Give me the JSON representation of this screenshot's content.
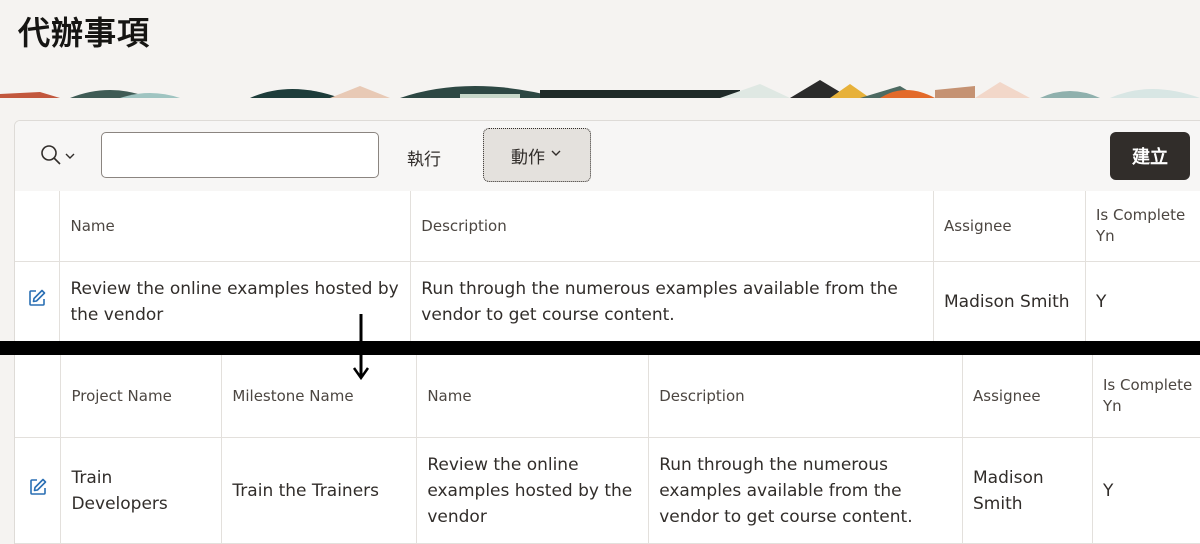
{
  "page": {
    "title": "代辦事項"
  },
  "toolbar": {
    "go_label": "執行",
    "actions_label": "動作",
    "create_label": "建立",
    "search_value": "",
    "search_placeholder": ""
  },
  "grid_before": {
    "headers": [
      "Name",
      "Description",
      "Assignee",
      "Is Complete Yn"
    ],
    "row": {
      "name": "Review the online examples hosted by the vendor",
      "description": "Run through the numerous examples available from the vendor to get course content.",
      "assignee": "Madison Smith",
      "is_complete": "Y"
    }
  },
  "grid_after": {
    "headers": [
      "Project Name",
      "Milestone Name",
      "Name",
      "Description",
      "Assignee",
      "Is Complete Yn"
    ],
    "row": {
      "project_name": "Train Developers",
      "milestone_name": "Train the Trainers",
      "name": "Review the online examples hosted by the vendor",
      "description": "Run through the numerous examples available from the vendor to get course content.",
      "assignee": "Madison Smith",
      "is_complete": "Y"
    }
  },
  "colors": {
    "accent_dark": "#312d2a",
    "edit_icon": "#2a6fb4",
    "page_bg": "#f5f3f1"
  },
  "icons": [
    "search-icon",
    "chevron-down-icon",
    "edit-icon",
    "down-arrow-icon"
  ]
}
